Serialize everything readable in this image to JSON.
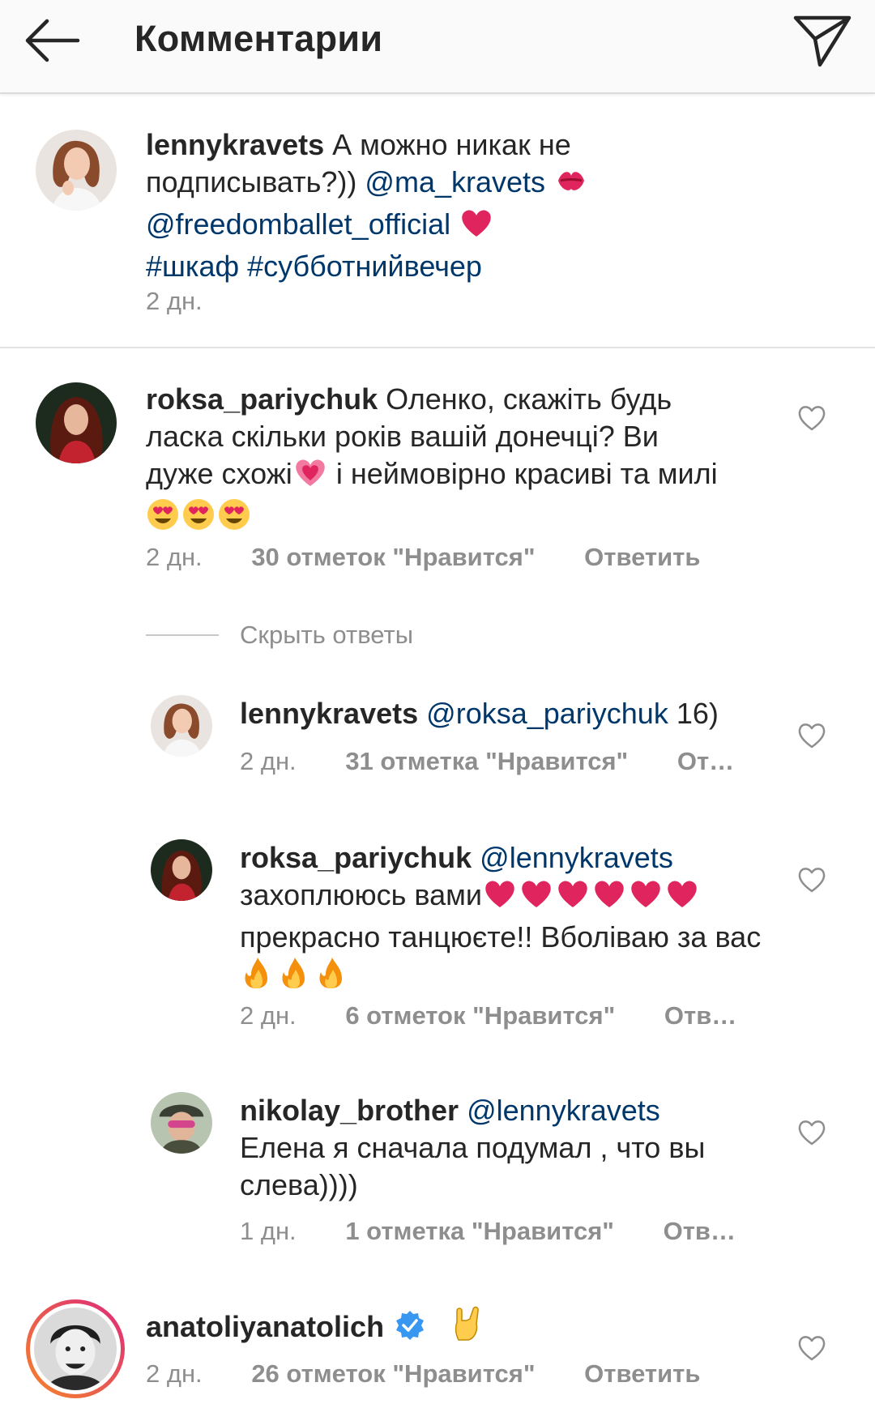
{
  "header": {
    "title": "Комментарии",
    "back_icon": "arrow-left-icon",
    "send_icon": "paper-plane-icon"
  },
  "caption": {
    "username": "lennykravets",
    "text_1": " А можно никак не подписывать?)) ",
    "mention_1": "@ma_kravets",
    "mention_2": "@freedomballet_official",
    "hashtag_1": "#шкаф",
    "hashtag_2": "#субботнийвечер",
    "time": "2 дн."
  },
  "comments": [
    {
      "username": "roksa_pariychuk",
      "text": " Оленко, скажіть будь ласка скільки років вашій донечці? Ви дуже схожі",
      "text_2": " і неймовірно красиві та милі",
      "time": "2 дн.",
      "likes": "30 отметок \"Нравится\"",
      "reply": "Ответить"
    }
  ],
  "hide_replies_label": "Скрыть ответы",
  "replies": [
    {
      "username": "lennykravets",
      "mention": "@roksa_pariychuk",
      "text": " 16)",
      "time": "2 дн.",
      "likes": "31 отметка \"Нравится\"",
      "reply": "От…"
    },
    {
      "username": "roksa_pariychuk",
      "mention": "@lennykravets",
      "text_1": "захоплююсь вами",
      "text_2": "прекрасно танцюєте!! Вболіваю за вас",
      "time": "2 дн.",
      "likes": "6 отметок \"Нравится\"",
      "reply": "Отв…"
    },
    {
      "username": "nikolay_brother",
      "mention": "@lennykravets",
      "text": "Елена я сначала подумал , что вы слева))))",
      "time": "1 дн.",
      "likes": "1 отметка \"Нравится\"",
      "reply": "Отв…"
    }
  ],
  "last_comment": {
    "username": "anatoliyanatolich",
    "time": "2 дн.",
    "likes": "26 отметок \"Нравится\"",
    "reply": "Ответить",
    "verified_icon": "verified-badge-icon"
  },
  "colors": {
    "link": "#00376b",
    "meta": "#8e8e8e",
    "text": "#262626",
    "heart_emoji": "#e0245e",
    "verified": "#3897f0",
    "story_ring_start": "#f58529",
    "story_ring_end": "#dd2a7b"
  }
}
